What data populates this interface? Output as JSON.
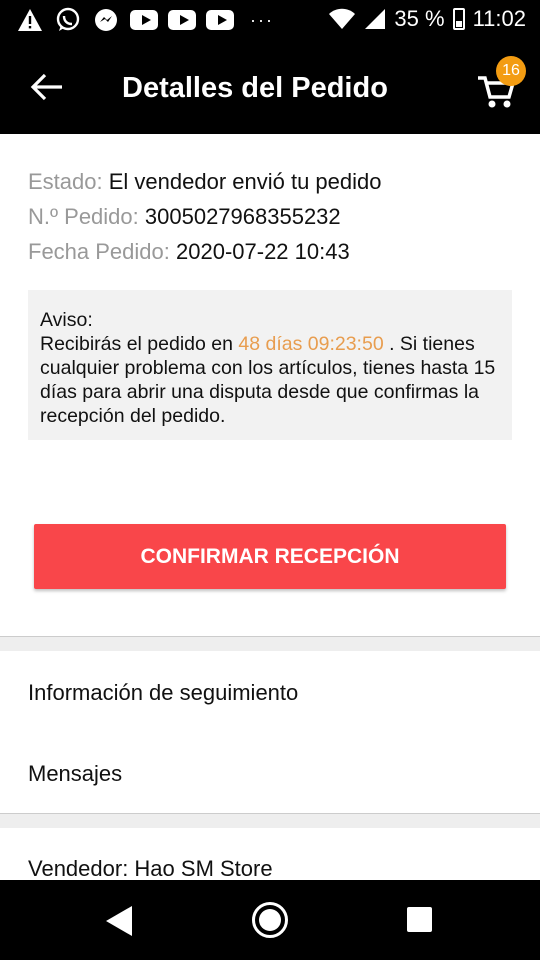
{
  "status_bar": {
    "battery": "35 %",
    "time": "11:02",
    "overflow": "···",
    "icons": [
      "warning-icon",
      "whatsapp-icon",
      "messenger-icon",
      "youtube-icon",
      "youtube-icon",
      "youtube-icon",
      "wifi-icon",
      "signal-icon",
      "battery-icon"
    ]
  },
  "app_bar": {
    "title": "Detalles del Pedido",
    "cart_badge": "16"
  },
  "order": {
    "status_label": "Estado:",
    "status_value": "El vendedor envió tu pedido",
    "number_label": "N.º Pedido:",
    "number_value": "3005027968355232",
    "date_label": "Fecha Pedido:",
    "date_value": "2020-07-22 10:43"
  },
  "notice": {
    "heading": "Aviso:",
    "text_before": "Recibirás el pedido en ",
    "highlight": "48 días 09:23:50",
    "text_after": " . Si tienes cualquier problema con los artículos, tienes hasta 15 días para abrir una disputa desde que confirmas la recepción del pedido."
  },
  "confirm_button": "CONFIRMAR RECEPCIÓN",
  "sections": {
    "tracking": "Información de seguimiento",
    "messages": "Mensajes",
    "seller": "Vendedor: Hao SM Store"
  },
  "colors": {
    "accent_red": "#f9464a",
    "highlight_orange": "#e89d4f",
    "badge_orange": "#f39c12"
  }
}
